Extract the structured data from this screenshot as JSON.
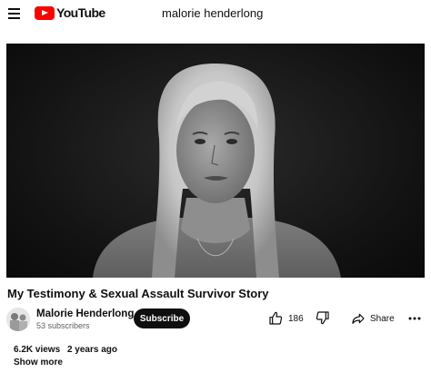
{
  "header": {
    "logo_text": "YouTube",
    "search_value": "malorie henderlong",
    "icons": {
      "menu": "hamburger-menu-icon",
      "logo": "youtube-play-logo-icon"
    },
    "brand_color": "#ff0000"
  },
  "video": {
    "title": "My Testimony & Sexual Assault Survivor Story",
    "player_style": "black-and-white"
  },
  "channel": {
    "name": "Malorie Henderlong",
    "subscribers": "53 subscribers",
    "subscribe_label": "Subscribe"
  },
  "actions": {
    "like_count": "186",
    "share_label": "Share",
    "icons": {
      "like": "thumbs-up-icon",
      "dislike": "thumbs-down-icon",
      "share": "share-arrow-icon",
      "more": "more-options-icon"
    }
  },
  "description": {
    "views": "6.2K views",
    "age": "2 years ago",
    "show_more_label": "Show more"
  }
}
